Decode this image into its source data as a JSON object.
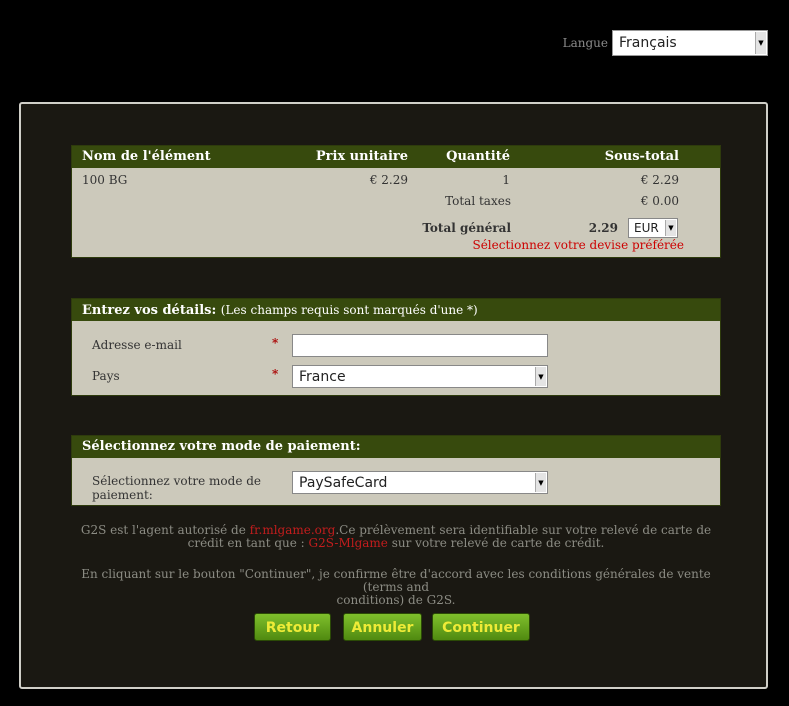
{
  "language": {
    "label": "Langue",
    "selected": "Français"
  },
  "cart": {
    "headers": {
      "item": "Nom de l'élément",
      "unit_price": "Prix unitaire",
      "quantity": "Quantité",
      "subtotal": "Sous-total"
    },
    "items": [
      {
        "name": "100 BG",
        "unit_price": "€ 2.29",
        "quantity": "1",
        "subtotal": "€ 2.29"
      }
    ],
    "total_taxes_label": "Total taxes",
    "total_taxes_value": "€ 0.00",
    "grand_total_label": "Total général",
    "grand_total_value": "2.29",
    "currency": "EUR",
    "currency_hint": "Sélectionnez votre devise préférée"
  },
  "details": {
    "heading_bold": "Entrez vos détails:",
    "heading_note": "(Les champs requis sont marqués d'une *)",
    "email_label": "Adresse e-mail",
    "email_value": "",
    "country_label": "Pays",
    "country_value": "France",
    "required_mark": "*"
  },
  "payment": {
    "heading": "Sélectionnez votre mode de paiement:",
    "label_line1": "Sélectionnez votre mode de",
    "label_line2": "paiement:",
    "method_value": "PaySafeCard"
  },
  "notice": {
    "part1": "G2S est l'agent autorisé de ",
    "link1": "fr.mlgame.org",
    "part2": ".Ce prélèvement sera identifiable sur votre relevé de carte de",
    "part3": "crédit en tant que : ",
    "link2": "G2S-Mlgame",
    "part4": " sur votre relevé de carte de crédit."
  },
  "terms": {
    "line1": "En cliquant sur le bouton \"Continuer\", je confirme être d'accord avec les conditions générales de vente (terms and",
    "line2": "conditions) de G2S."
  },
  "buttons": {
    "back": "Retour",
    "cancel": "Annuler",
    "continue": "Continuer"
  }
}
